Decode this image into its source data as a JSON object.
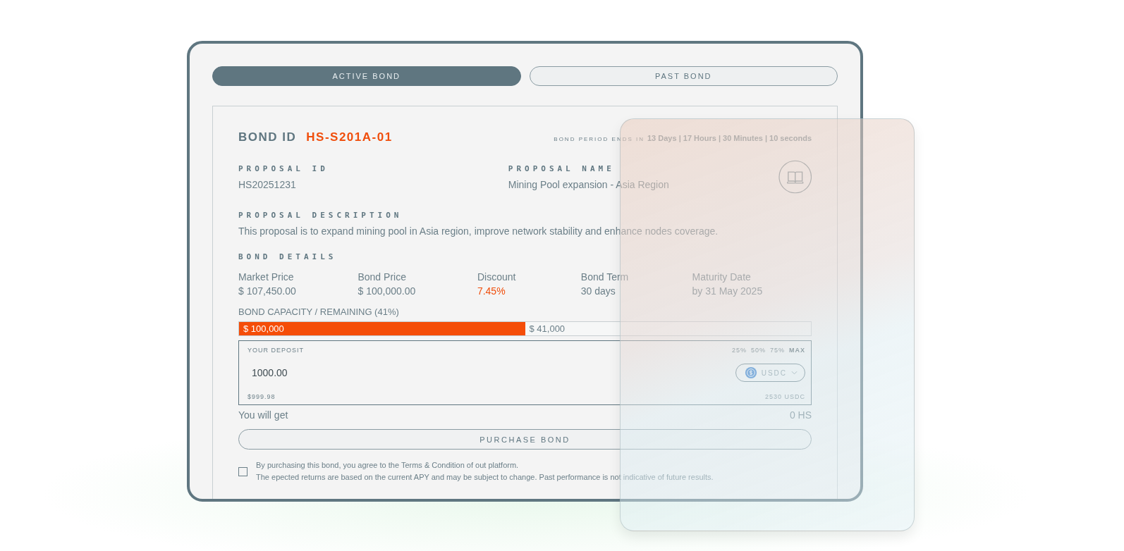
{
  "tabs": [
    {
      "label": "ACTIVE BOND",
      "selected": true
    },
    {
      "label": "PAST BOND",
      "selected": false
    }
  ],
  "bond": {
    "id_label": "BOND ID",
    "id": "HS-S201A-01",
    "period_label": "BOND PERIOD ENDS IN",
    "period": "13 Days | 17 Hours | 30 Minutes | 10 seconds"
  },
  "proposal": {
    "id_label": "PROPOSAL ID",
    "id": "HS20251231",
    "name_label": "PROPOSAL NAME",
    "name": "Mining Pool expansion - Asia Region",
    "description_label": "PROPOSAL DESCRIPTION",
    "description": "This proposal is to expand mining pool in Asia region, improve network stability and enhance nodes coverage."
  },
  "details": {
    "heading": "BOND DETAILS",
    "items": [
      {
        "label": "Market Price",
        "value": "$ 107,450.00",
        "kind": "plain"
      },
      {
        "label": "Bond Price",
        "value": "$ 100,000.00",
        "kind": "plain"
      },
      {
        "label": "Discount",
        "value": "7.45%",
        "kind": "highlight"
      },
      {
        "label": "Bond Term",
        "value": "30 days",
        "kind": "plain"
      },
      {
        "label": "Maturity Date",
        "value": "by 31 May 2025",
        "kind": "plain"
      }
    ]
  },
  "capacity": {
    "label": "BOND CAPACITY / REMAINING (41%)",
    "level": 0.5,
    "filled": "$ 100,000",
    "remaining": "$ 41,000"
  },
  "deposit": {
    "label": "YOUR DEPOSIT",
    "presets": [
      "25%",
      "50%",
      "75%",
      "MAX"
    ],
    "value": "1000.00",
    "token": "USDC",
    "usd_value": "$999.98",
    "balance": "2530 USDC"
  },
  "receive": {
    "label": "You will get",
    "value": "0 HS"
  },
  "purchase_button": "PURCHASE BOND",
  "agreement": {
    "checked": false,
    "lines": [
      "By purchasing this bond, you agree to the Terms & Condition of out platform.",
      "The epected returns are based on the current APY and may be subject to change. Past performance is not indicative of future results."
    ]
  }
}
